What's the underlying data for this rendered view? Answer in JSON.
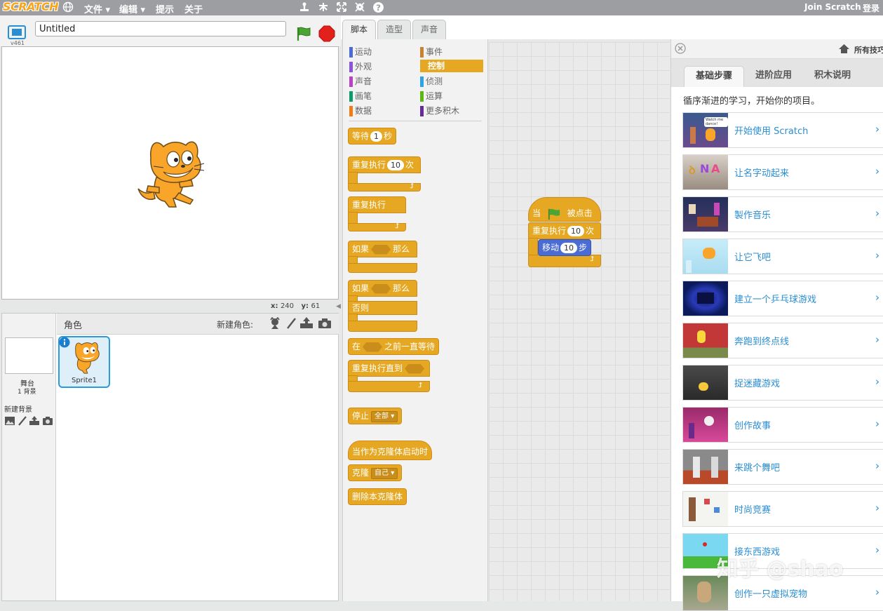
{
  "menubar": {
    "logo": "SCRATCH",
    "file": "文件",
    "edit": "编辑",
    "tips": "提示",
    "about": "关于",
    "join": "Join Scratch",
    "login": "登录"
  },
  "stage": {
    "title_value": "Untitled",
    "version": "v461",
    "coords_x_label": "x:",
    "coords_x": "240",
    "coords_y_label": "y:",
    "coords_y": "61"
  },
  "sprites": {
    "header": "角色",
    "new_sprite": "新建角色:",
    "stage_label": "舞台",
    "stage_backdrops": "1 背景",
    "new_backdrop": "新建背景",
    "sprite_name": "Sprite1"
  },
  "tabs": [
    "脚本",
    "造型",
    "声音"
  ],
  "categories": {
    "motion": "运动",
    "looks": "外观",
    "sound": "声音",
    "pen": "画笔",
    "data": "数据",
    "events": "事件",
    "control": "控制",
    "sensing": "侦测",
    "operators": "运算",
    "more": "更多积木"
  },
  "blocks": {
    "wait_a": "等待",
    "wait_val": "1",
    "wait_b": "秒",
    "repeat_a": "重复执行",
    "repeat_val": "10",
    "repeat_b": "次",
    "forever": "重复执行",
    "if_a": "如果",
    "if_b": "那么",
    "if2_a": "如果",
    "if2_b": "那么",
    "else": "否则",
    "waituntil_a": "在",
    "waituntil_b": "之前一直等待",
    "repeatuntil": "重复执行直到",
    "stop": "停止",
    "stop_opt": "全部",
    "clone_start": "当作为克隆体启动时",
    "clone": "克隆",
    "clone_opt": "自己",
    "delete_clone": "删除本克隆体"
  },
  "script": {
    "hat_a": "当",
    "hat_b": "被点击",
    "repeat_a": "重复执行",
    "repeat_val": "10",
    "repeat_b": "次",
    "move_a": "移动",
    "move_val": "10",
    "move_b": "步"
  },
  "tips": {
    "all_tips": "所有技巧",
    "tab_basic": "基础步骤",
    "tab_advanced": "进阶应用",
    "tab_blocks": "积木说明",
    "intro": "循序渐进的学习，开始你的项目。",
    "items": [
      "开始使用 Scratch",
      "让名字动起来",
      "製作音乐",
      "让它飞吧",
      "建立一个乒乓球游戏",
      "奔跑到终点线",
      "捉迷藏游戏",
      "创作故事",
      "来跳个舞吧",
      "时尚竞赛",
      "接东西游戏",
      "创作一只虚拟宠物"
    ],
    "thumb_text": "Watch me dance!"
  },
  "watermark": "知乎 @shao",
  "colors": {
    "control": "#e6a822",
    "motion": "#4a6cd4",
    "looks": "#8a55d7",
    "sound": "#bb42c3",
    "pen": "#0e9a6c",
    "data": "#ee7d16",
    "events": "#c88330",
    "sensing": "#2ca5e2",
    "operators": "#5cb712",
    "more": "#632d99"
  }
}
